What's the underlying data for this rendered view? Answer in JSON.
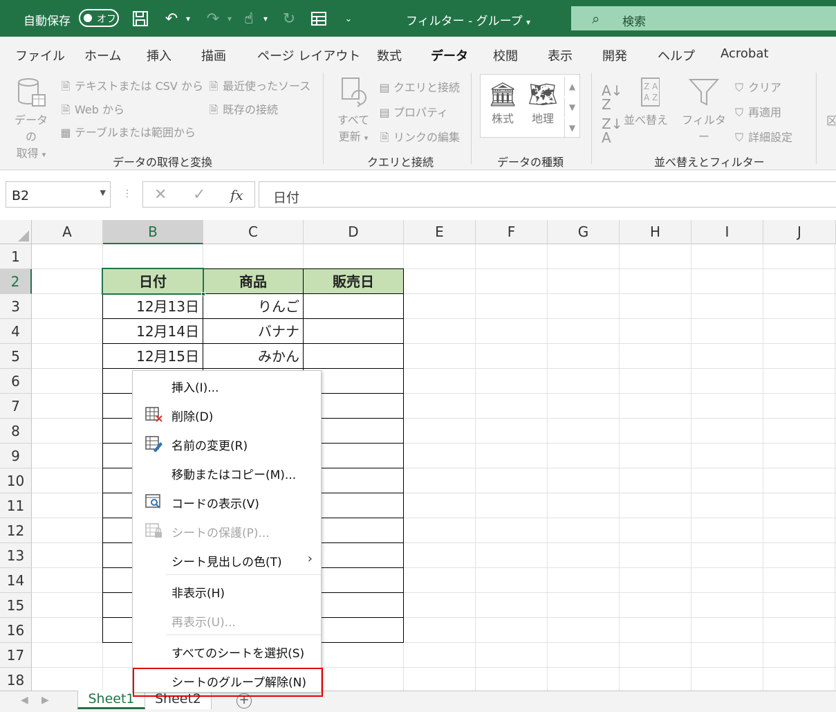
{
  "titlebar": {
    "autosave_label": "自動保存",
    "toggle_state": "オフ",
    "doc_title": "フィルター  -  グループ",
    "search_placeholder": "検索"
  },
  "ribbon": {
    "tabs": [
      "ファイル",
      "ホーム",
      "挿入",
      "描画",
      "ページ レイアウト",
      "数式",
      "データ",
      "校閲",
      "表示",
      "開発",
      "ヘルプ",
      "Acrobat"
    ],
    "active_tab": "データ",
    "get_data": {
      "big_label_1": "データの",
      "big_label_2": "取得",
      "from_text_csv": "テキストまたは CSV から",
      "from_web": "Web から",
      "from_table": "テーブルまたは範囲から",
      "recent_sources": "最近使ったソース",
      "existing_connections": "既存の接続",
      "group_label": "データの取得と変換"
    },
    "queries": {
      "refresh_1": "すべて",
      "refresh_2": "更新",
      "queries_connections": "クエリと接続",
      "properties": "プロパティ",
      "edit_links": "リンクの編集",
      "group_label": "クエリと接続"
    },
    "data_types": {
      "stocks": "株式",
      "geography": "地理",
      "group_label": "データの種類"
    },
    "sort_filter": {
      "sort": "並べ替え",
      "filter": "フィルター",
      "clear": "クリア",
      "reapply": "再適用",
      "advanced": "詳細設定",
      "group_label": "並べ替えとフィルター"
    },
    "overflow_label": "区"
  },
  "formula_bar": {
    "name_box": "B2",
    "formula": "日付"
  },
  "sheet": {
    "columns": [
      "A",
      "B",
      "C",
      "D",
      "E",
      "F",
      "G",
      "H",
      "I",
      "J"
    ],
    "selected_column": "B",
    "rows": [
      "1",
      "2",
      "3",
      "4",
      "5",
      "6",
      "7",
      "8",
      "9",
      "10",
      "11",
      "12",
      "13",
      "14",
      "15",
      "16",
      "17",
      "18"
    ],
    "selected_row": "2",
    "headers": [
      "日付",
      "商品",
      "販売日"
    ],
    "data": [
      [
        "12月13日",
        "りんご",
        ""
      ],
      [
        "12月14日",
        "バナナ",
        ""
      ],
      [
        "12月15日",
        "みかん",
        ""
      ]
    ]
  },
  "sheet_tabs": [
    "Sheet1",
    "Sheet2"
  ],
  "context_menu": {
    "items": [
      {
        "label": "挿入(I)...",
        "icon": "none",
        "disabled": false
      },
      {
        "label": "削除(D)",
        "icon": "delete-sheet-icon",
        "disabled": false
      },
      {
        "label": "名前の変更(R)",
        "icon": "rename-sheet-icon",
        "disabled": false
      },
      {
        "label": "移動またはコピー(M)...",
        "icon": "none",
        "disabled": false
      },
      {
        "label": "コードの表示(V)",
        "icon": "view-code-icon",
        "disabled": false
      },
      {
        "label": "シートの保護(P)...",
        "icon": "protect-sheet-icon",
        "disabled": true
      },
      {
        "label": "シート見出しの色(T)",
        "icon": "none",
        "disabled": false
      },
      {
        "label": "非表示(H)",
        "icon": "none",
        "disabled": false
      },
      {
        "label": "再表示(U)...",
        "icon": "none",
        "disabled": true
      },
      {
        "label": "すべてのシートを選択(S)",
        "icon": "none",
        "disabled": false
      },
      {
        "label": "シートのグループ解除(N)",
        "icon": "none",
        "disabled": false
      }
    ],
    "highlighted_item": "シートのグループ解除(N)"
  },
  "colors": {
    "brand_green": "#217346",
    "header_fill": "#c6e0b4",
    "highlight_red": "#e00000"
  }
}
